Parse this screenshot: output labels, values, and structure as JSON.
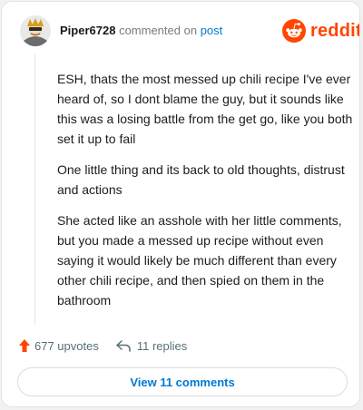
{
  "header": {
    "username": "Piper6728",
    "commented_on": "commented on",
    "post_link": "post"
  },
  "logo": {
    "wordmark": "reddit",
    "icon": "reddit-alien-icon",
    "color": "#ff4500"
  },
  "comment": {
    "paragraphs": [
      "ESH, thats the most messed up chili recipe I've ever heard of, so I dont blame the guy, but it sounds like this was a losing battle from the get go, like you both set it up to fail",
      "One little thing and its back to old thoughts, distrust and actions",
      "She acted like an asshole with her little comments, but you made a messed up recipe without even saying it would likely be much different than every other chili recipe, and then spied on them in the bathroom"
    ]
  },
  "actions": {
    "upvotes": "677 upvotes",
    "upvote_icon": "upvote-arrow-icon",
    "replies": "11 replies",
    "reply_icon": "reply-arrow-icon",
    "upvote_color": "#ff4500"
  },
  "view_comments_label": "View 11 comments"
}
